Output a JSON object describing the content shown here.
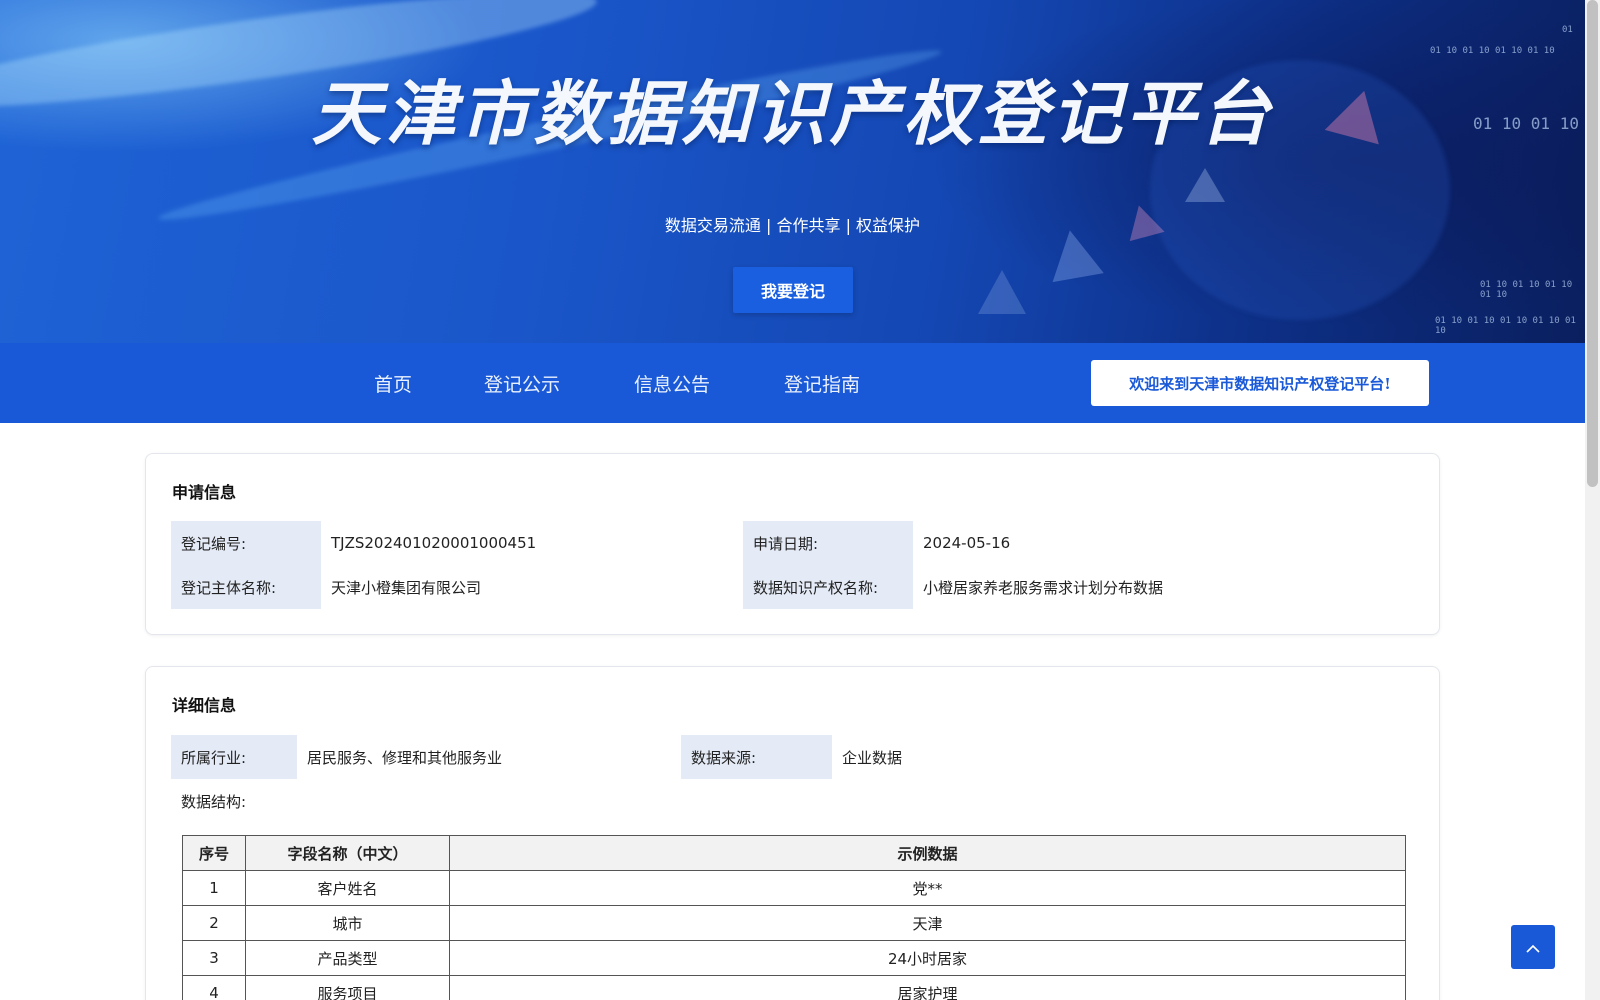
{
  "banner": {
    "title": "天津市数据知识产权登记平台",
    "subtitle": "数据交易流通 | 合作共享 | 权益保护",
    "register_button": "我要登记",
    "binary_texts": [
      "01 10 01 10 01 10 01 10",
      "01 10 01 10",
      "01 10 01 10 01 10 01 10",
      "01 10 01 10 01 10 01 10 01 10",
      "01"
    ]
  },
  "nav": {
    "items": [
      "首页",
      "登记公示",
      "信息公告",
      "登记指南"
    ],
    "welcome": "欢迎来到天津市数据知识产权登记平台!"
  },
  "application": {
    "title": "申请信息",
    "reg_no_label": "登记编号:",
    "reg_no": "TJZS202401020001000451",
    "apply_date_label": "申请日期:",
    "apply_date": "2024-05-16",
    "subject_label": "登记主体名称:",
    "subject": "天津小橙集团有限公司",
    "ip_name_label": "数据知识产权名称:",
    "ip_name": "小橙居家养老服务需求计划分布数据"
  },
  "detail": {
    "title": "详细信息",
    "industry_label": "所属行业:",
    "industry": "居民服务、修理和其他服务业",
    "source_label": "数据来源:",
    "source": "企业数据",
    "structure_label": "数据结构:",
    "table": {
      "headers": [
        "序号",
        "字段名称（中文）",
        "示例数据"
      ],
      "rows": [
        [
          "1",
          "客户姓名",
          "党**"
        ],
        [
          "2",
          "城市",
          "天津"
        ],
        [
          "3",
          "产品类型",
          "24小时居家"
        ],
        [
          "4",
          "服务项目",
          "居家护理"
        ]
      ]
    }
  },
  "colors": {
    "primary": "#1959d8",
    "label_bg": "#e4ebf7"
  },
  "icons": {
    "back_to_top": "chevron-up-icon"
  }
}
